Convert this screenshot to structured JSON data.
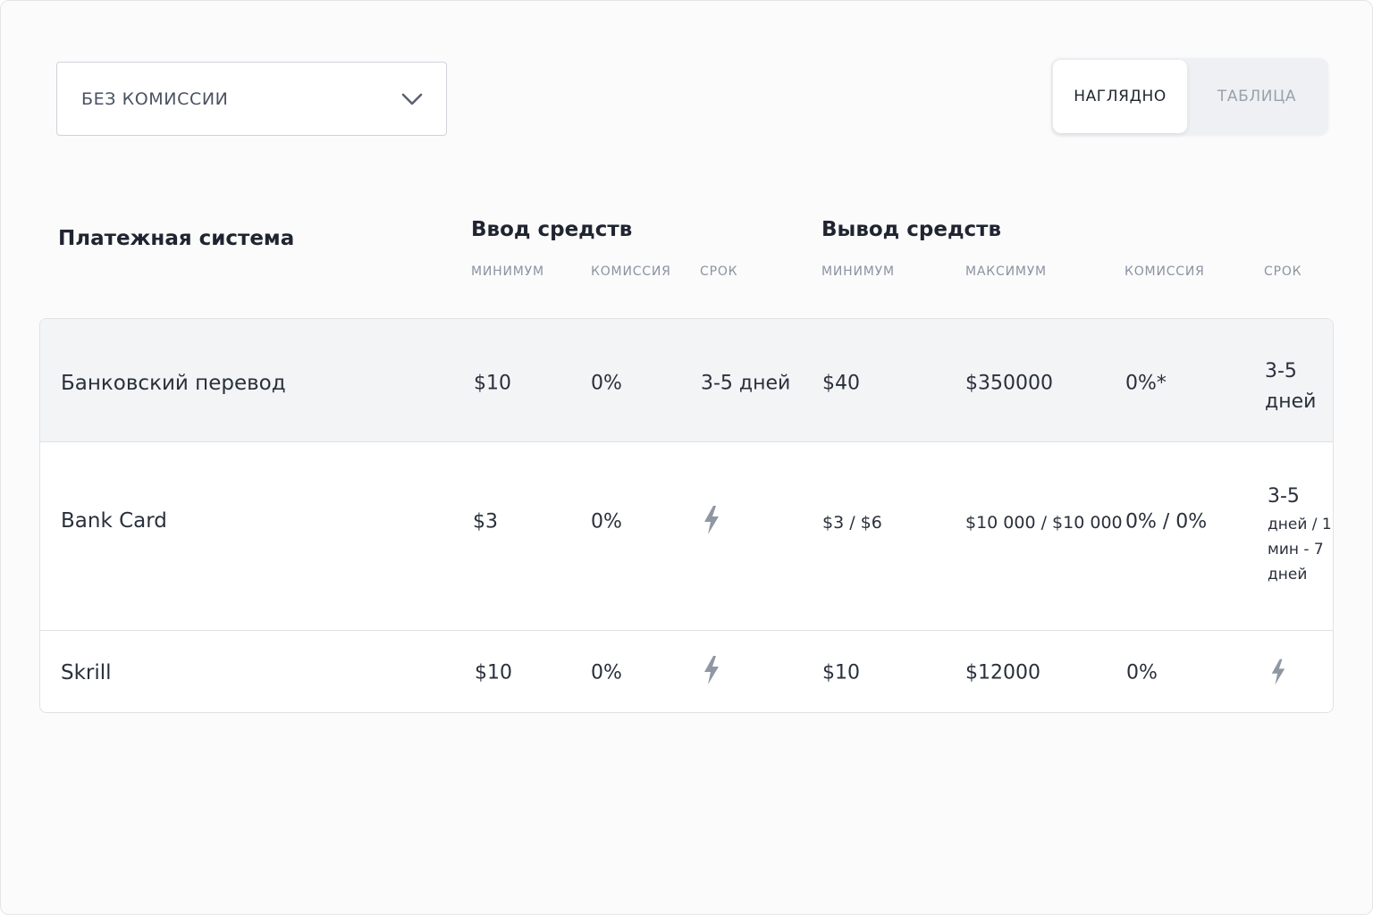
{
  "filter": {
    "selected": "БЕЗ КОМИССИИ",
    "icon": "chevron-down-icon"
  },
  "view_toggle": {
    "visual": "НАГЛЯДНО",
    "table": "ТАБЛИЦА",
    "active": "visual"
  },
  "header": {
    "payment_system": "Платежная система",
    "deposit": {
      "title": "Ввод средств",
      "columns": [
        "МИНИМУМ",
        "КОМИССИЯ",
        "СРОК"
      ]
    },
    "withdrawal": {
      "title": "Вывод средств",
      "columns": [
        "МИНИМУМ",
        "МАКСИМУМ",
        "КОМИССИЯ",
        "СРОК"
      ]
    }
  },
  "rows": [
    {
      "name": "Банковский перевод",
      "deposit": {
        "min": "$10",
        "commission": "0%",
        "term": "3-5 дней"
      },
      "withdrawal": {
        "min": "$40",
        "max": "$350000",
        "commission": "0%*",
        "term_line1": "3-5",
        "term_line2": "дней"
      }
    },
    {
      "name": "Bank Card",
      "deposit": {
        "min": "$3",
        "commission": "0%",
        "term_icon": "lightning-icon"
      },
      "withdrawal": {
        "min": "$3 /  $6",
        "max": "$10 000 / $10 000",
        "commission": "0% / 0%",
        "term_line1": "3-5",
        "term_line2": "дней / 1",
        "term_line3": "мин - 7",
        "term_line4": "дней"
      }
    },
    {
      "name": "Skrill",
      "deposit": {
        "min": "$10",
        "commission": "0%",
        "term_icon": "lightning-icon"
      },
      "withdrawal": {
        "min": "$10",
        "max": "$12000",
        "commission": "0%",
        "term_icon": "lightning-icon"
      }
    }
  ],
  "colors": {
    "row_highlight": "#f3f4f6",
    "icon_gray": "#8f97a3",
    "border": "#dfe2e6"
  }
}
